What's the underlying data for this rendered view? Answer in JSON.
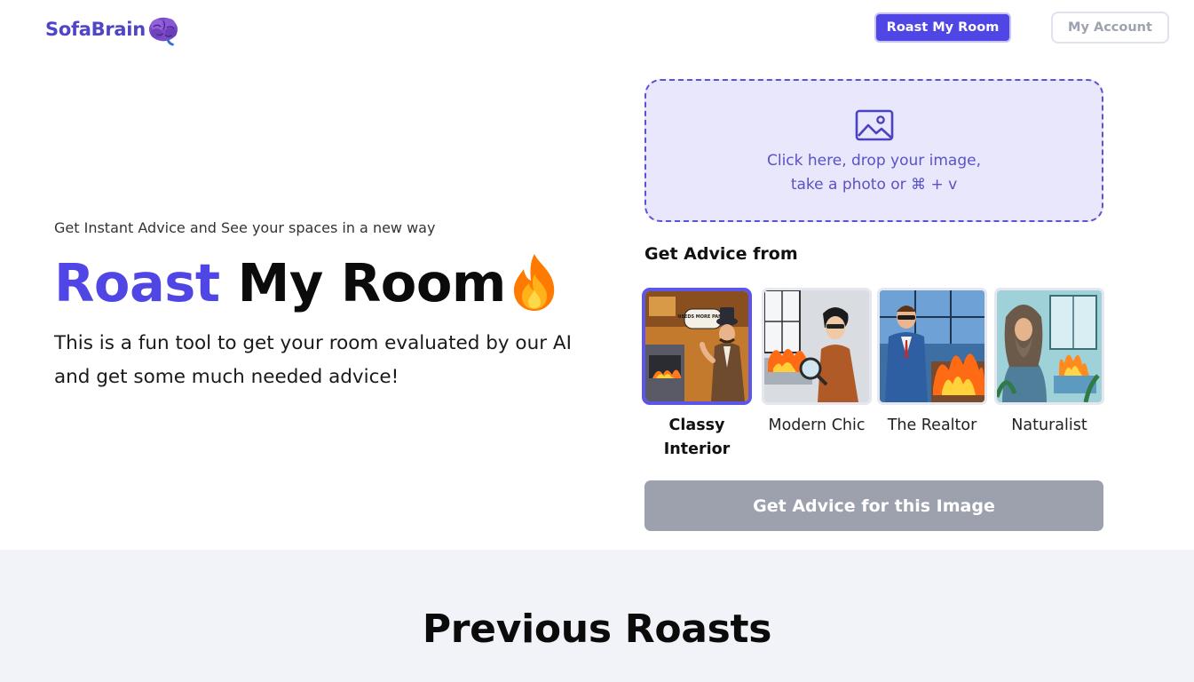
{
  "header": {
    "logo_text": "SofaBrain",
    "logo_icon": "brain-icon",
    "roast_button": "Roast My Room",
    "account_button": "My Account"
  },
  "hero": {
    "tagline": "Get Instant Advice and See your spaces in a new way",
    "title_accent": "Roast",
    "title_rest": "My Room",
    "flame_icon": "flame-icon",
    "description": "This is a fun tool to get your room evaluated by our AI and get some much needed advice!"
  },
  "upload": {
    "icon": "image-icon",
    "line1": "Click here, drop your image,",
    "line2": "take a photo or ⌘ + v"
  },
  "advisors": {
    "heading": "Get Advice from",
    "items": [
      {
        "label": "Classy Interior",
        "selected": true
      },
      {
        "label": "Modern Chic",
        "selected": false
      },
      {
        "label": "The Realtor",
        "selected": false
      },
      {
        "label": "Naturalist",
        "selected": false
      }
    ],
    "speech_bubble": "NEEDS MORE PANS.."
  },
  "actions": {
    "get_advice": "Get Advice for this Image"
  },
  "previous": {
    "title": "Previous Roasts"
  },
  "colors": {
    "accent": "#5046e5",
    "upload_bg": "#e8e7fb",
    "button_disabled": "#9ca1ad",
    "section_bg": "#f1f3f8"
  }
}
